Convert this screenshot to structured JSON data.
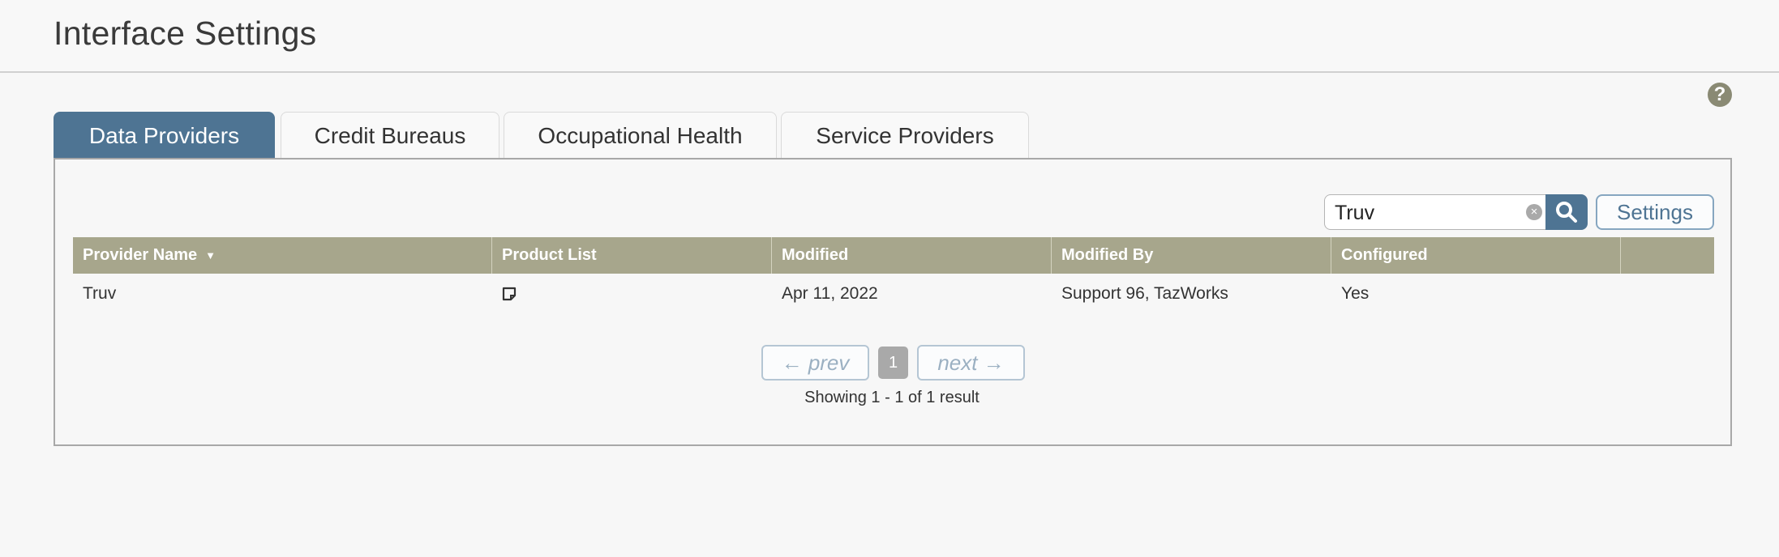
{
  "page": {
    "title": "Interface Settings",
    "help_glyph": "?"
  },
  "tabs": [
    {
      "label": "Data Providers",
      "active": true
    },
    {
      "label": "Credit Bureaus",
      "active": false
    },
    {
      "label": "Occupational Health",
      "active": false
    },
    {
      "label": "Service Providers",
      "active": false
    }
  ],
  "toolbar": {
    "search_value": "Truv",
    "clear_glyph": "×",
    "settings_label": "Settings"
  },
  "table": {
    "columns": [
      "Provider Name",
      "Product List",
      "Modified",
      "Modified By",
      "Configured"
    ],
    "sort_glyph": "▼",
    "rows": [
      {
        "provider_name": "Truv",
        "product_list_icon": "document-icon",
        "modified": "Apr 11, 2022",
        "modified_by": "Support 96, TazWorks",
        "configured": "Yes"
      }
    ]
  },
  "pagination": {
    "prev_label": "← prev",
    "current_page": "1",
    "next_label": "next →",
    "summary": "Showing 1 - 1 of 1 result"
  },
  "colors": {
    "accent": "#4e7493",
    "table_header": "#a7a68c",
    "page_number_bg": "#a9a9a9"
  }
}
